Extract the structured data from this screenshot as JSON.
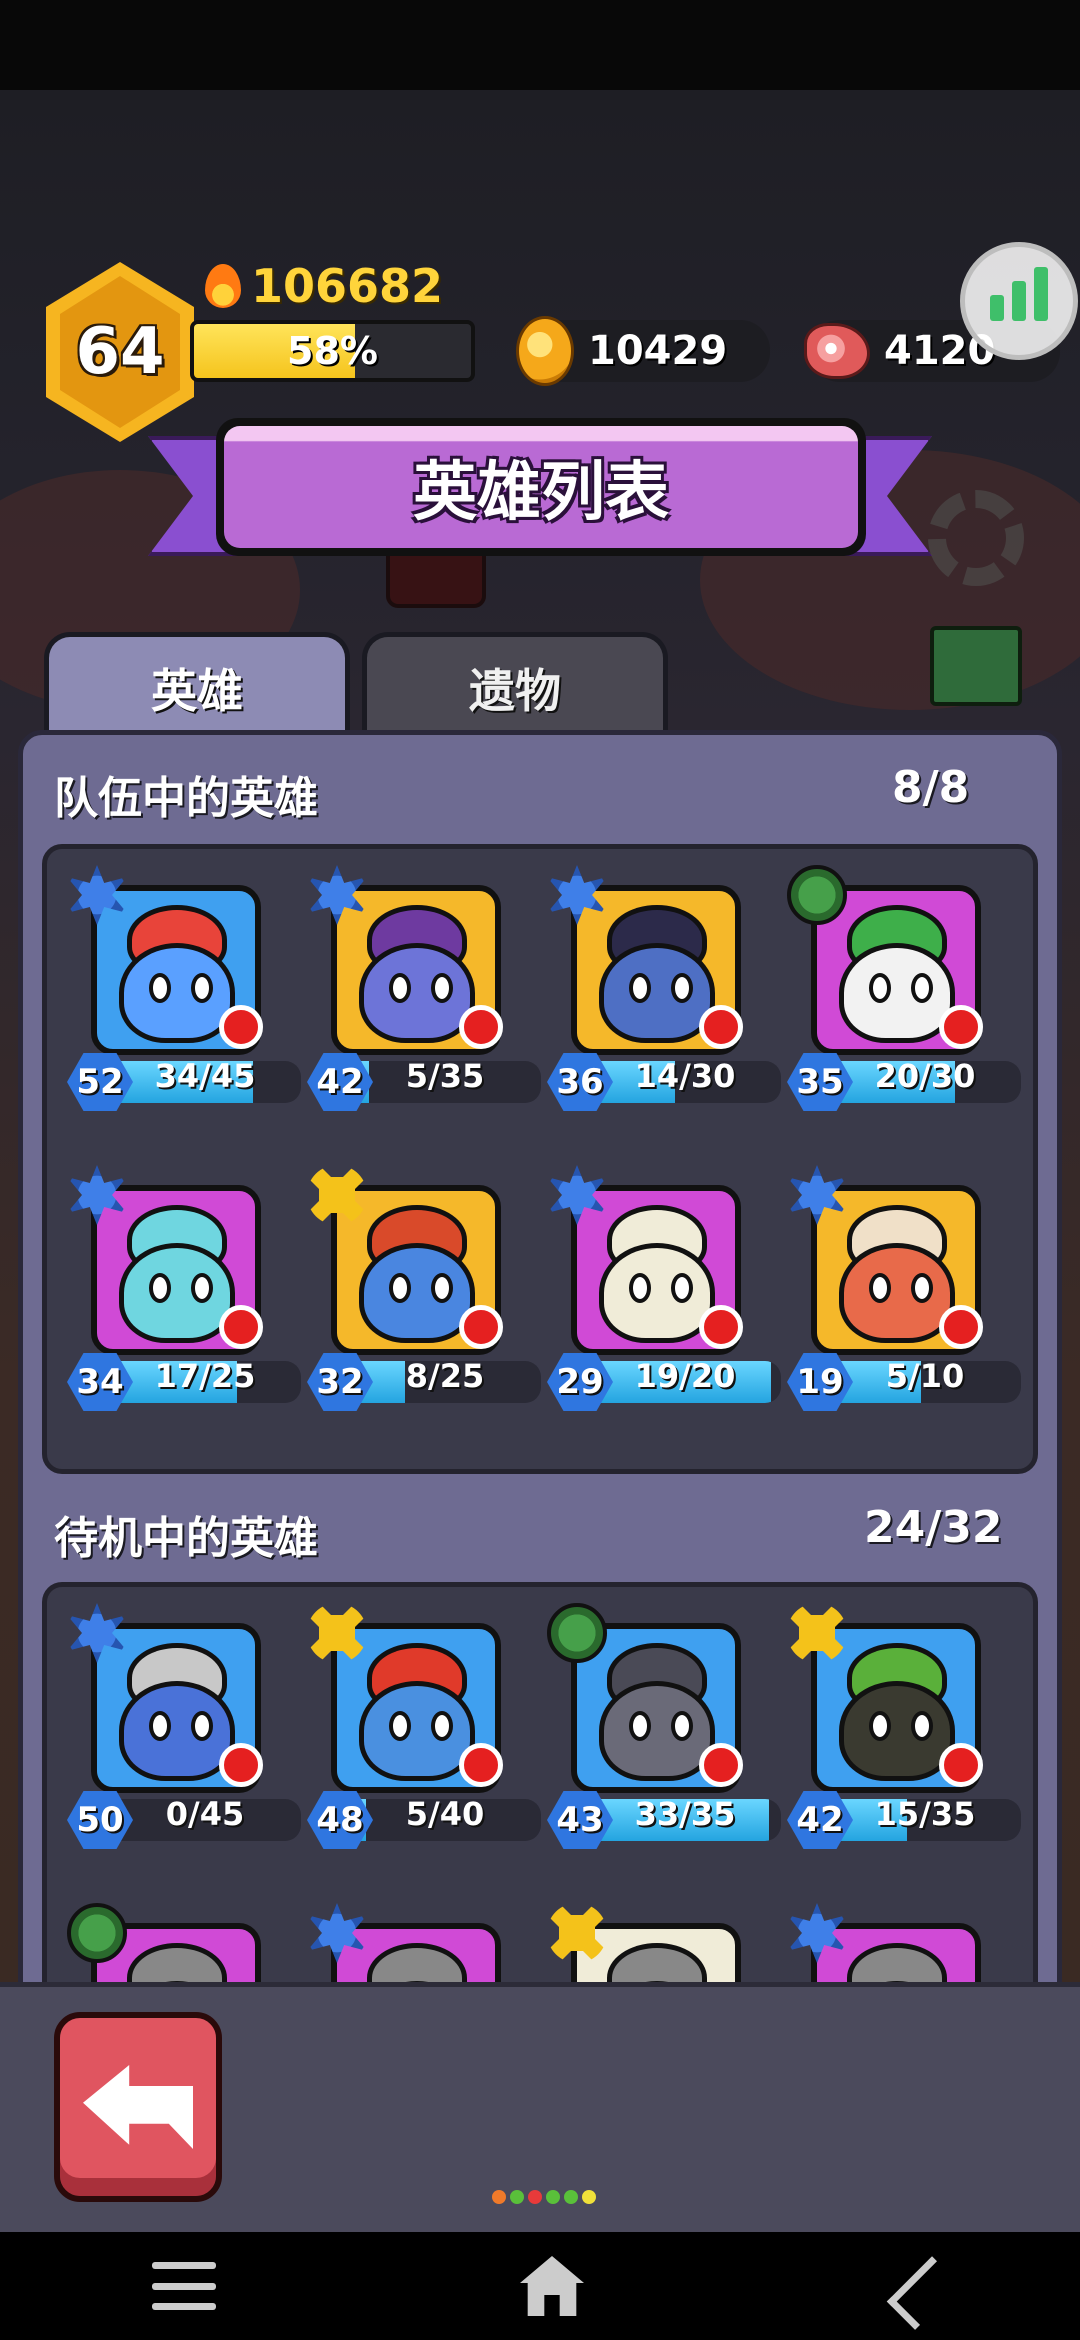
{
  "header": {
    "level": "64",
    "power": "106682",
    "xp_percent_text": "58%",
    "xp_fraction": 0.58,
    "coins": "10429",
    "meat": "4120"
  },
  "title": "英雄列表",
  "tabs": [
    {
      "label": "英雄",
      "active": true
    },
    {
      "label": "遗物",
      "active": false
    }
  ],
  "team_section": {
    "title": "队伍中的英雄",
    "count": "8/8",
    "heroes": [
      {
        "level": "52",
        "progress": "34/45",
        "fill": 0.76,
        "class": "blue",
        "bg": "#3fa0f0",
        "body": "#5aa0ff",
        "hat": "#e8443a"
      },
      {
        "level": "42",
        "progress": "5/35",
        "fill": 0.14,
        "class": "blue",
        "bg": "#f5b82a",
        "body": "#6d74d8",
        "hat": "#6e3aa0"
      },
      {
        "level": "36",
        "progress": "14/30",
        "fill": 0.47,
        "class": "blue",
        "bg": "#f5b82a",
        "body": "#4e6fc4",
        "hat": "#2c2a4a"
      },
      {
        "level": "35",
        "progress": "20/30",
        "fill": 0.67,
        "class": "green",
        "bg": "#d04ad6",
        "body": "#f2f2f2",
        "hat": "#3eaf4a"
      },
      {
        "level": "34",
        "progress": "17/25",
        "fill": 0.68,
        "class": "blue",
        "bg": "#d04ad6",
        "body": "#6fd6e0",
        "hat": "#6fd6e0"
      },
      {
        "level": "32",
        "progress": "8/25",
        "fill": 0.32,
        "class": "yellow",
        "bg": "#f5b82a",
        "body": "#4a86e0",
        "hat": "#d94a2a"
      },
      {
        "level": "29",
        "progress": "19/20",
        "fill": 0.95,
        "class": "blue",
        "bg": "#d04ad6",
        "body": "#f0ecd8",
        "hat": "#f0ecd8"
      },
      {
        "level": "19",
        "progress": "5/10",
        "fill": 0.5,
        "class": "blue",
        "bg": "#f5b82a",
        "body": "#e86a4a",
        "hat": "#f0e0c8"
      }
    ]
  },
  "idle_section": {
    "title": "待机中的英雄",
    "count": "24/32",
    "heroes": [
      {
        "level": "50",
        "progress": "0/45",
        "fill": 0.0,
        "class": "blue",
        "bg": "#3fa0f0",
        "body": "#4a72d8",
        "hat": "#c8c8c8"
      },
      {
        "level": "48",
        "progress": "5/40",
        "fill": 0.125,
        "class": "yellow",
        "bg": "#3fa0f0",
        "body": "#4a90e0",
        "hat": "#e03a2a"
      },
      {
        "level": "43",
        "progress": "33/35",
        "fill": 0.94,
        "class": "green",
        "bg": "#3fa0f0",
        "body": "#6a6a78",
        "hat": "#4a4a56"
      },
      {
        "level": "42",
        "progress": "15/35",
        "fill": 0.43,
        "class": "yellow",
        "bg": "#3fa0f0",
        "body": "#3a3a30",
        "hat": "#5ab03a"
      }
    ],
    "partial_row_classes": [
      "green",
      "blue",
      "yellow",
      "blue"
    ],
    "partial_row_bgs": [
      "#d04ad6",
      "#d04ad6",
      "#f0ecd8",
      "#d04ad6"
    ]
  },
  "page_dots": [
    "#f07a2a",
    "#5ac03a",
    "#e83a3a",
    "#5ac03a",
    "#5ac03a",
    "#f0e03a"
  ]
}
